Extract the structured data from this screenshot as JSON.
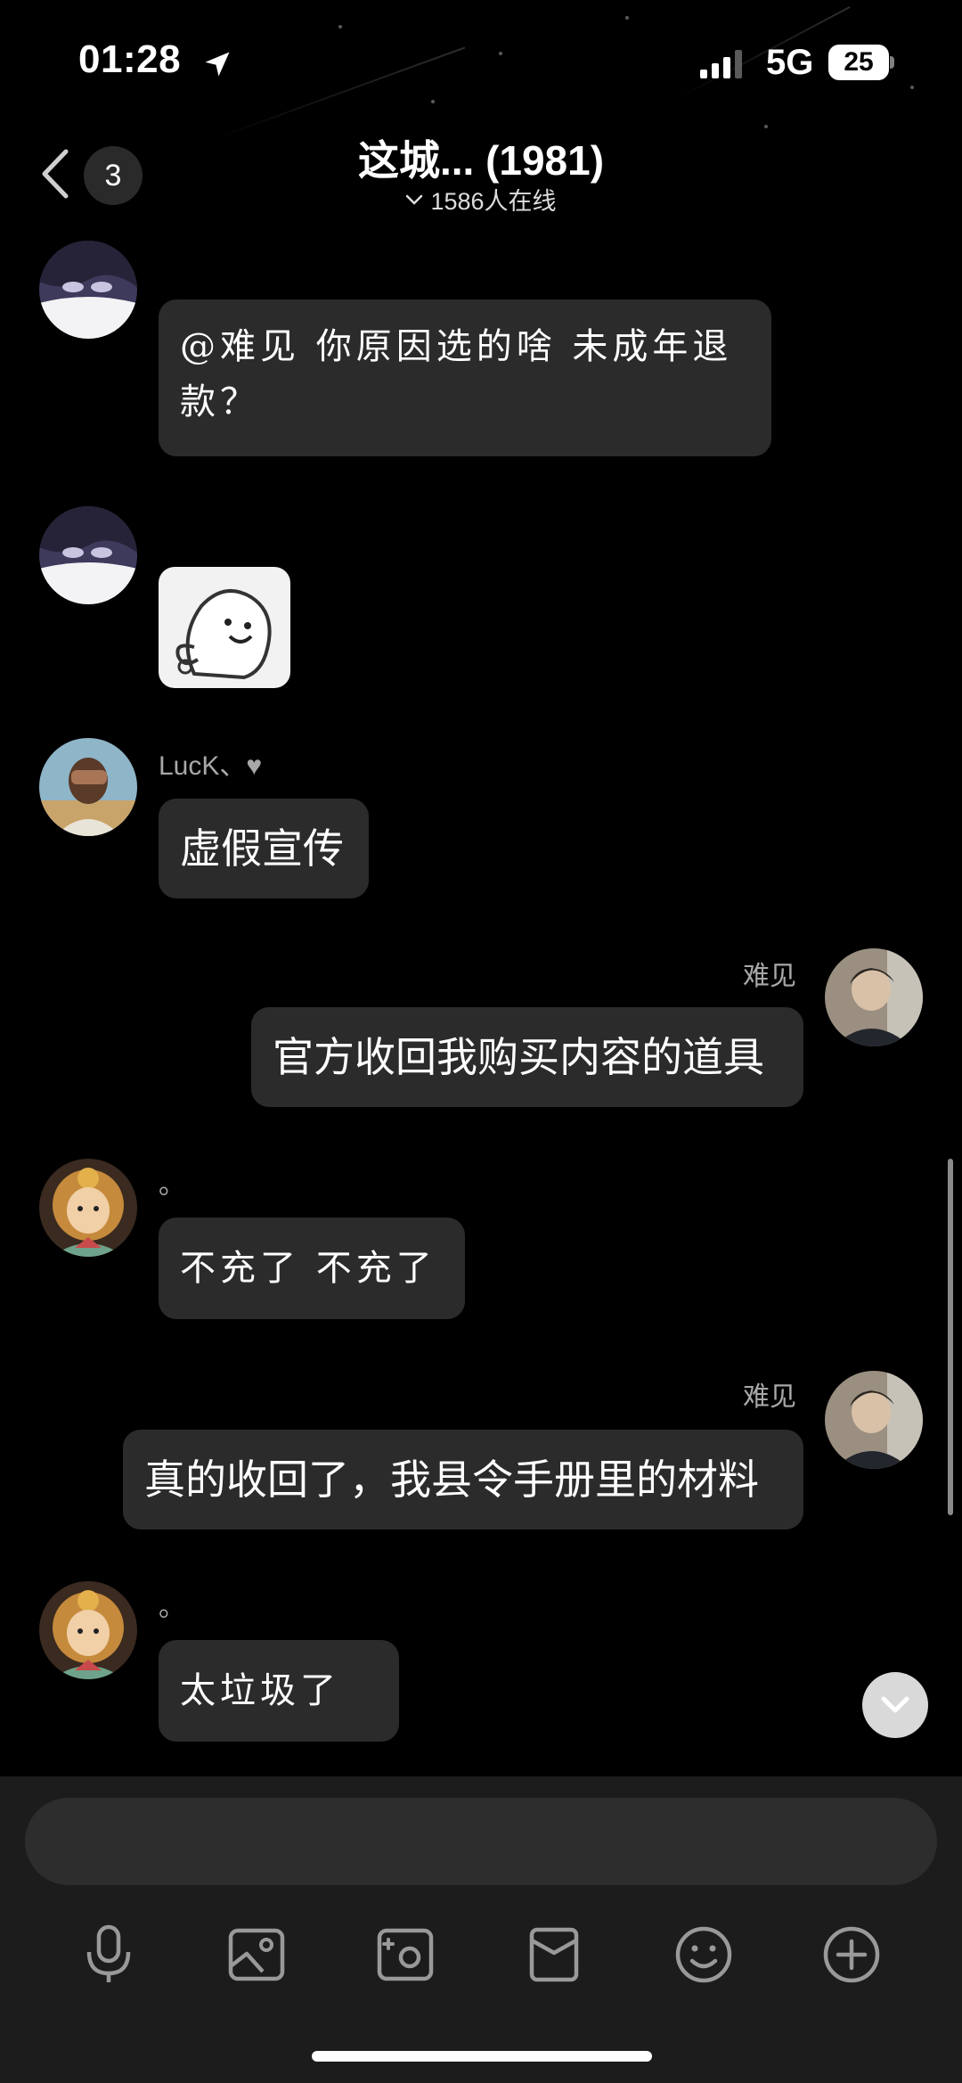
{
  "status_bar": {
    "time": "01:28",
    "network": "5G",
    "battery": "25",
    "icons": [
      "location-arrow-icon",
      "signal-bars-icon"
    ]
  },
  "header": {
    "back_icon": "chevron-left-icon",
    "unread_count": "3",
    "title": "这城... (1981)",
    "online_text": "1586人在线"
  },
  "messages": [
    {
      "side": "left",
      "sender": "",
      "type": "text",
      "text_lines": [
        "@难见 你原因选的啥 未成年退",
        "款？"
      ]
    },
    {
      "side": "left",
      "sender": "",
      "type": "sticker",
      "sticker": "ghost-doodle-sticker"
    },
    {
      "side": "left",
      "sender": "LucK、♥",
      "type": "text",
      "text": "虚假宣传"
    },
    {
      "side": "right",
      "sender": "难见",
      "type": "text",
      "text": "官方收回我购买内容的道具"
    },
    {
      "side": "left",
      "sender": "。",
      "type": "text",
      "text": "不充了 不充了"
    },
    {
      "side": "right",
      "sender": "难见",
      "type": "text",
      "text": "真的收回了，我县令手册里的材料"
    },
    {
      "side": "left",
      "sender": "。",
      "type": "text",
      "text": "太垃圾了"
    }
  ],
  "input": {
    "placeholder": ""
  },
  "toolbar": [
    "microphone-icon",
    "image-icon",
    "camera-icon",
    "red-packet-icon",
    "emoji-icon",
    "plus-icon"
  ],
  "colors": {
    "background": "#000000",
    "bubble": "#2b2b2b",
    "input_bar": "#1c1c1c"
  }
}
